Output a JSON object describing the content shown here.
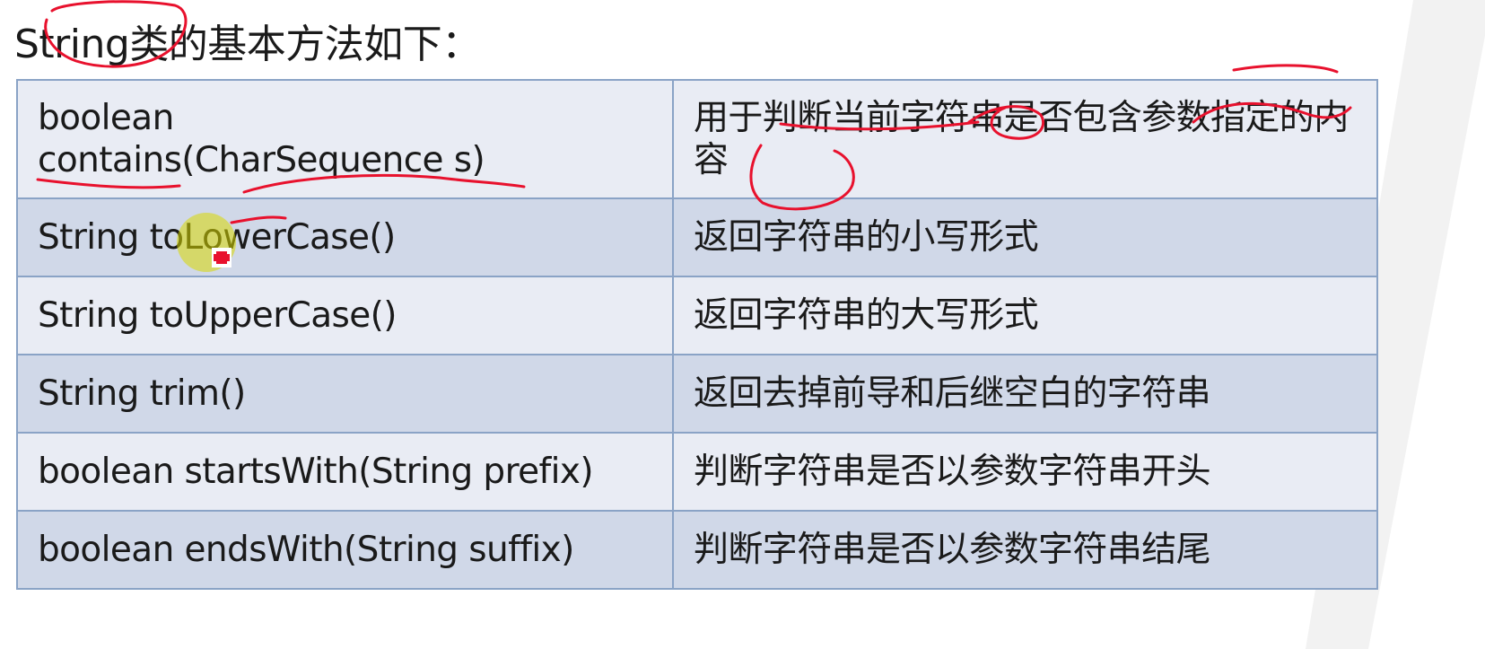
{
  "slide": {
    "title": "String类的基本方法如下："
  },
  "table": {
    "rows": [
      {
        "signature": "boolean\ncontains(CharSequence s)",
        "description": "用于判断当前字符串是否包含参数指定的内容"
      },
      {
        "signature": "String toLowerCase()",
        "description": "返回字符串的小写形式"
      },
      {
        "signature": "String toUpperCase()",
        "description": "返回字符串的大写形式"
      },
      {
        "signature": "String trim()",
        "description": "返回去掉前导和后继空白的字符串"
      },
      {
        "signature": "boolean startsWith(String prefix)",
        "description": "判断字符串是否以参数字符串开头"
      },
      {
        "signature": "boolean endsWith(String suffix)",
        "description": "判断字符串是否以参数字符串结尾"
      }
    ]
  },
  "colors": {
    "row_light": "#e9ecf4",
    "row_dark": "#d0d8e8",
    "border": "#8aa3c6",
    "annotation_ink": "#e8112d",
    "cursor_highlight": "#d8d800"
  },
  "icons": {
    "cursor": "red-plus-cursor-icon"
  }
}
